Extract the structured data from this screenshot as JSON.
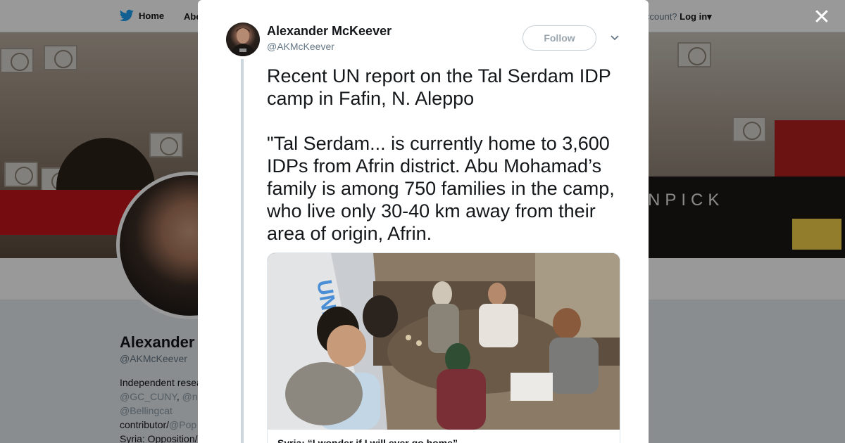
{
  "topnav": {
    "home_label": "Home",
    "about_label": "Abo",
    "account_prompt": "ccount?",
    "login_label": "Log in"
  },
  "profile": {
    "name": "Alexander M",
    "handle": "@AKMcKeever",
    "bio_line1": "Independent resea",
    "bio_link1": "@GC_CUNY",
    "bio_sep": ", ",
    "bio_link2": "@n",
    "bio_link3": "@Bellingcat",
    "bio_line3_prefix": "contributor/",
    "bio_link4": "@Pop",
    "bio_line4": "Syria: Opposition/"
  },
  "banner": {
    "shop_sign": "NPICK"
  },
  "modal": {
    "close_icon": "close-icon",
    "tweet": {
      "author_name": "Alexander McKeever",
      "author_handle": "@AKMcKeever",
      "follow_label": "Follow",
      "text": "Recent UN report on the Tal Serdam IDP camp in Fafin, N. Aleppo\n\n\"Tal Serdam... is currently home to 3,600 IDPs from Afrin district. Abu Mohamad’s family is among 750 families in the camp, who live only 30-40 km away from their area of origin, Afrin.",
      "card_title": "Syria: “I wonder if I will ever go home”"
    }
  },
  "colors": {
    "twitter_blue": "#1da1f2",
    "text": "#14171a",
    "muted": "#657786",
    "overlay": "rgba(0,0,0,0.4)"
  }
}
